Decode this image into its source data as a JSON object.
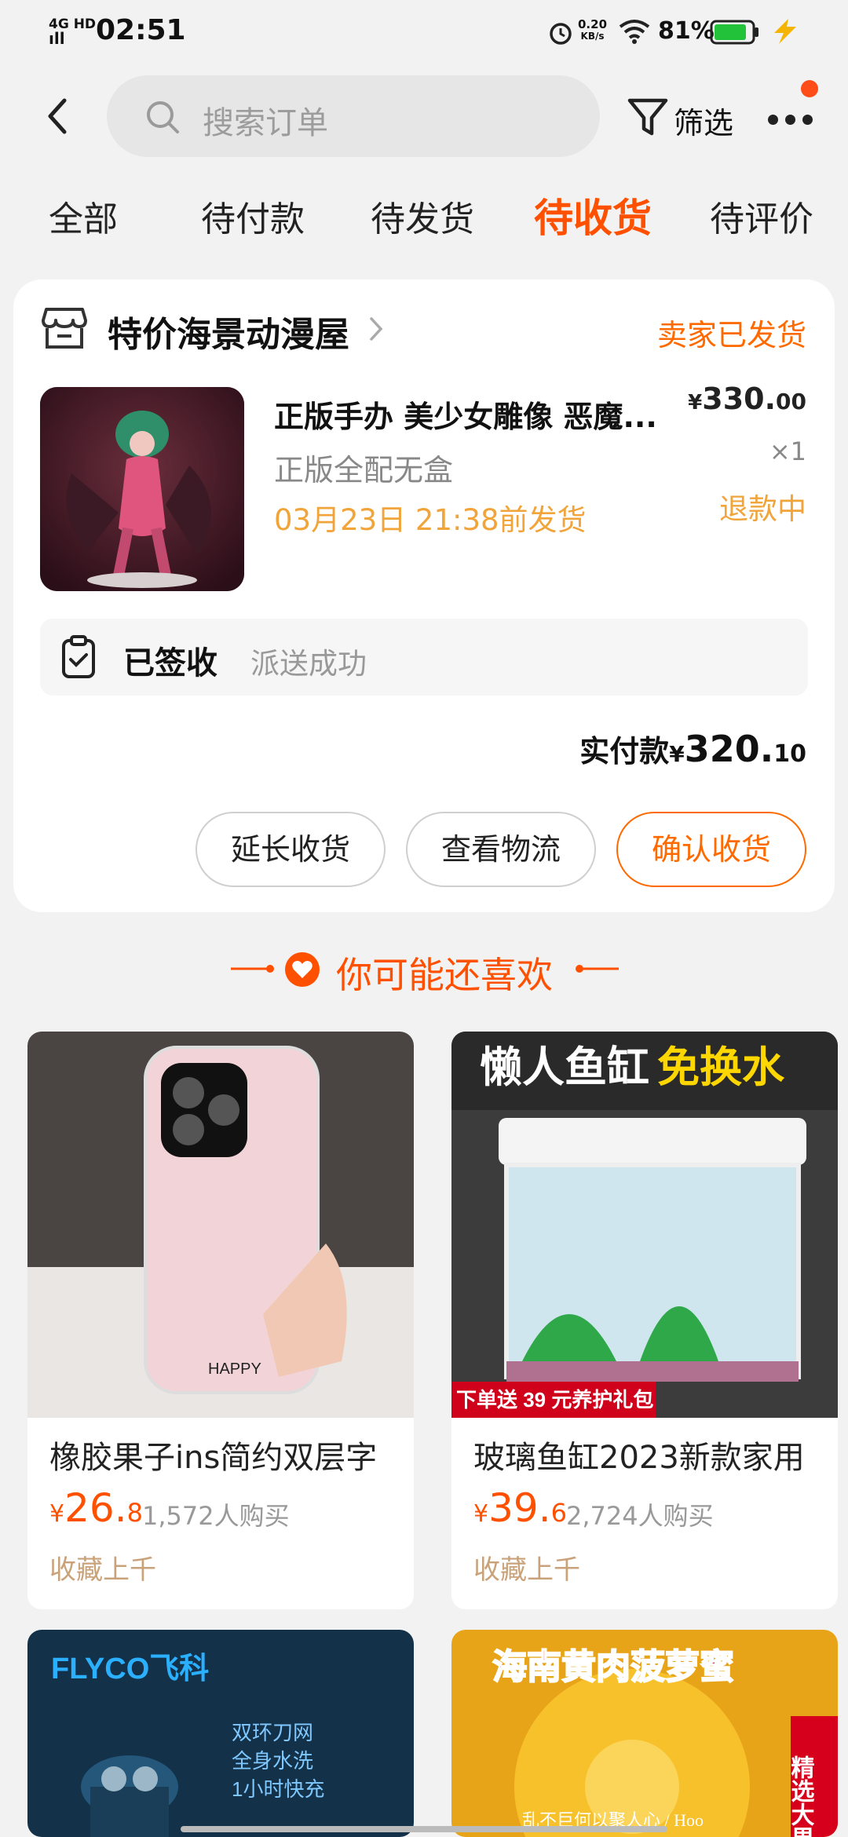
{
  "status_bar": {
    "network_top": "4G HD",
    "network_bottom": "ıll",
    "time": "02:51",
    "speed_value": "0.20",
    "speed_unit": "KB/s",
    "battery_pct": "81%"
  },
  "header": {
    "search_placeholder": "搜索订单",
    "filter_label": "筛选"
  },
  "tabs": [
    {
      "label": "全部",
      "active": false
    },
    {
      "label": "待付款",
      "active": false
    },
    {
      "label": "待发货",
      "active": false
    },
    {
      "label": "待收货",
      "active": true
    },
    {
      "label": "待评价",
      "active": false
    }
  ],
  "order": {
    "shop_name": "特价海景动漫屋",
    "ship_status": "卖家已发货",
    "item_title": "正版手办  美少女雕像 恶魔...",
    "item_spec": "正版全配无盒",
    "deadline": "03月23日 21:38前发货",
    "price_symbol": "¥",
    "price_int": "330.",
    "price_dec": "00",
    "quantity": "×1",
    "refund_status": "退款中",
    "sign_title": "已签收",
    "sign_desc": "派送成功",
    "paid_label": "实付款",
    "paid_symbol": "¥",
    "paid_int": "320.",
    "paid_dec": "10",
    "buttons": {
      "extend": "延长收货",
      "logistics": "查看物流",
      "confirm": "确认收货"
    }
  },
  "recommend": {
    "title": "你可能还喜欢",
    "products": [
      {
        "name": "橡胶果子ins简约双层字",
        "price_symbol": "¥",
        "price_int": "26.",
        "price_dec": "8",
        "sold": "1,572人购买",
        "tag": "收藏上千",
        "image_text": "HAPPY"
      },
      {
        "name": "玻璃鱼缸2023新款家用",
        "price_symbol": "¥",
        "price_int": "39.",
        "price_dec": "6",
        "sold": "2,724人购买",
        "tag": "收藏上千",
        "image_text_a": "懒人鱼缸",
        "image_text_b": "免换水",
        "image_banner": "下单送 39 元养护礼包"
      },
      {
        "name": "",
        "image_brand": "FLYCO飞科",
        "image_lines": [
          "双环刀网",
          "全身水洗",
          "1小时快充"
        ]
      },
      {
        "name": "",
        "image_text": "海南黄肉菠萝蜜",
        "image_side": "精选大果",
        "image_caption": "乱不巨何以聚人心 / Hoo"
      }
    ]
  },
  "colors": {
    "accent": "#ff5000",
    "warn": "#f0a43a",
    "tag": "#c9a27a"
  }
}
